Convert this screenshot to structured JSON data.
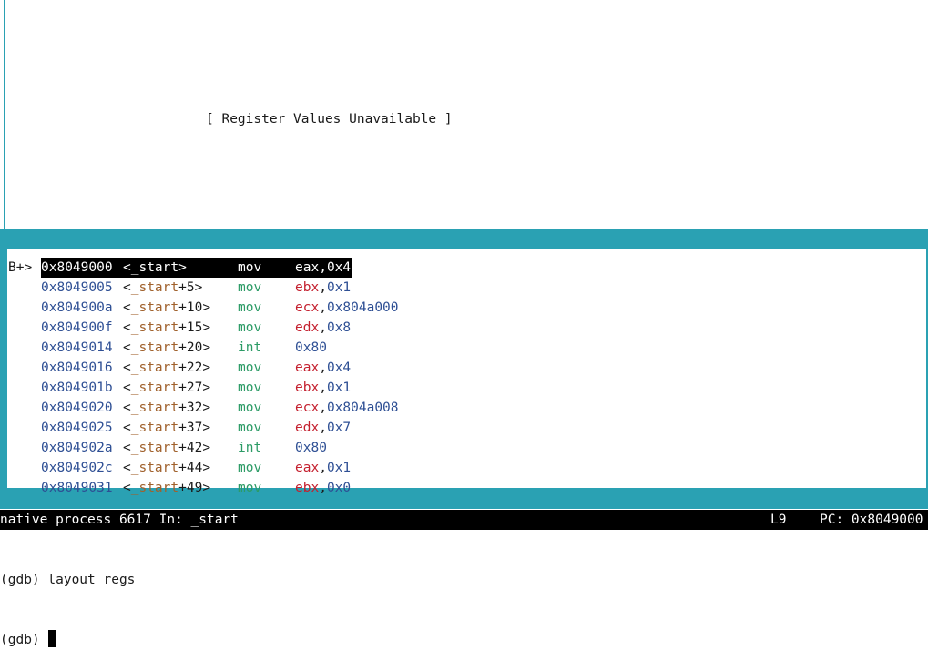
{
  "registers_window": {
    "message": "[ Register Values Unavailable ]"
  },
  "asm": {
    "breakpoint_marker": "B+>",
    "lines": [
      {
        "addr": "0x8049000",
        "sym": "_start",
        "offset": "",
        "op": "mov",
        "arg1": "eax",
        "arg2": "0x4",
        "current": true
      },
      {
        "addr": "0x8049005",
        "sym": "_start",
        "offset": "+5",
        "op": "mov",
        "arg1": "ebx",
        "arg2": "0x1",
        "current": false
      },
      {
        "addr": "0x804900a",
        "sym": "_start",
        "offset": "+10",
        "op": "mov",
        "arg1": "ecx",
        "arg2": "0x804a000",
        "current": false
      },
      {
        "addr": "0x804900f",
        "sym": "_start",
        "offset": "+15",
        "op": "mov",
        "arg1": "edx",
        "arg2": "0x8",
        "current": false
      },
      {
        "addr": "0x8049014",
        "sym": "_start",
        "offset": "+20",
        "op": "int",
        "arg1": "",
        "arg2": "0x80",
        "current": false
      },
      {
        "addr": "0x8049016",
        "sym": "_start",
        "offset": "+22",
        "op": "mov",
        "arg1": "eax",
        "arg2": "0x4",
        "current": false
      },
      {
        "addr": "0x804901b",
        "sym": "_start",
        "offset": "+27",
        "op": "mov",
        "arg1": "ebx",
        "arg2": "0x1",
        "current": false
      },
      {
        "addr": "0x8049020",
        "sym": "_start",
        "offset": "+32",
        "op": "mov",
        "arg1": "ecx",
        "arg2": "0x804a008",
        "current": false
      },
      {
        "addr": "0x8049025",
        "sym": "_start",
        "offset": "+37",
        "op": "mov",
        "arg1": "edx",
        "arg2": "0x7",
        "current": false
      },
      {
        "addr": "0x804902a",
        "sym": "_start",
        "offset": "+42",
        "op": "int",
        "arg1": "",
        "arg2": "0x80",
        "current": false
      },
      {
        "addr": "0x804902c",
        "sym": "_start",
        "offset": "+44",
        "op": "mov",
        "arg1": "eax",
        "arg2": "0x1",
        "current": false
      },
      {
        "addr": "0x8049031",
        "sym": "_start",
        "offset": "+49",
        "op": "mov",
        "arg1": "ebx",
        "arg2": "0x0",
        "current": false
      }
    ]
  },
  "status_bar": {
    "process": "native process 6617 In: _start",
    "line": "L9",
    "pc": "PC: 0x8049000"
  },
  "command_area": {
    "lines": [
      "(gdb) layout regs",
      "(gdb) "
    ]
  },
  "colors": {
    "frame": "#2aa1b3",
    "address": "#2e4f94",
    "symbol": "#a0612c",
    "opcode": "#2c9b66",
    "register": "#c4202f"
  }
}
